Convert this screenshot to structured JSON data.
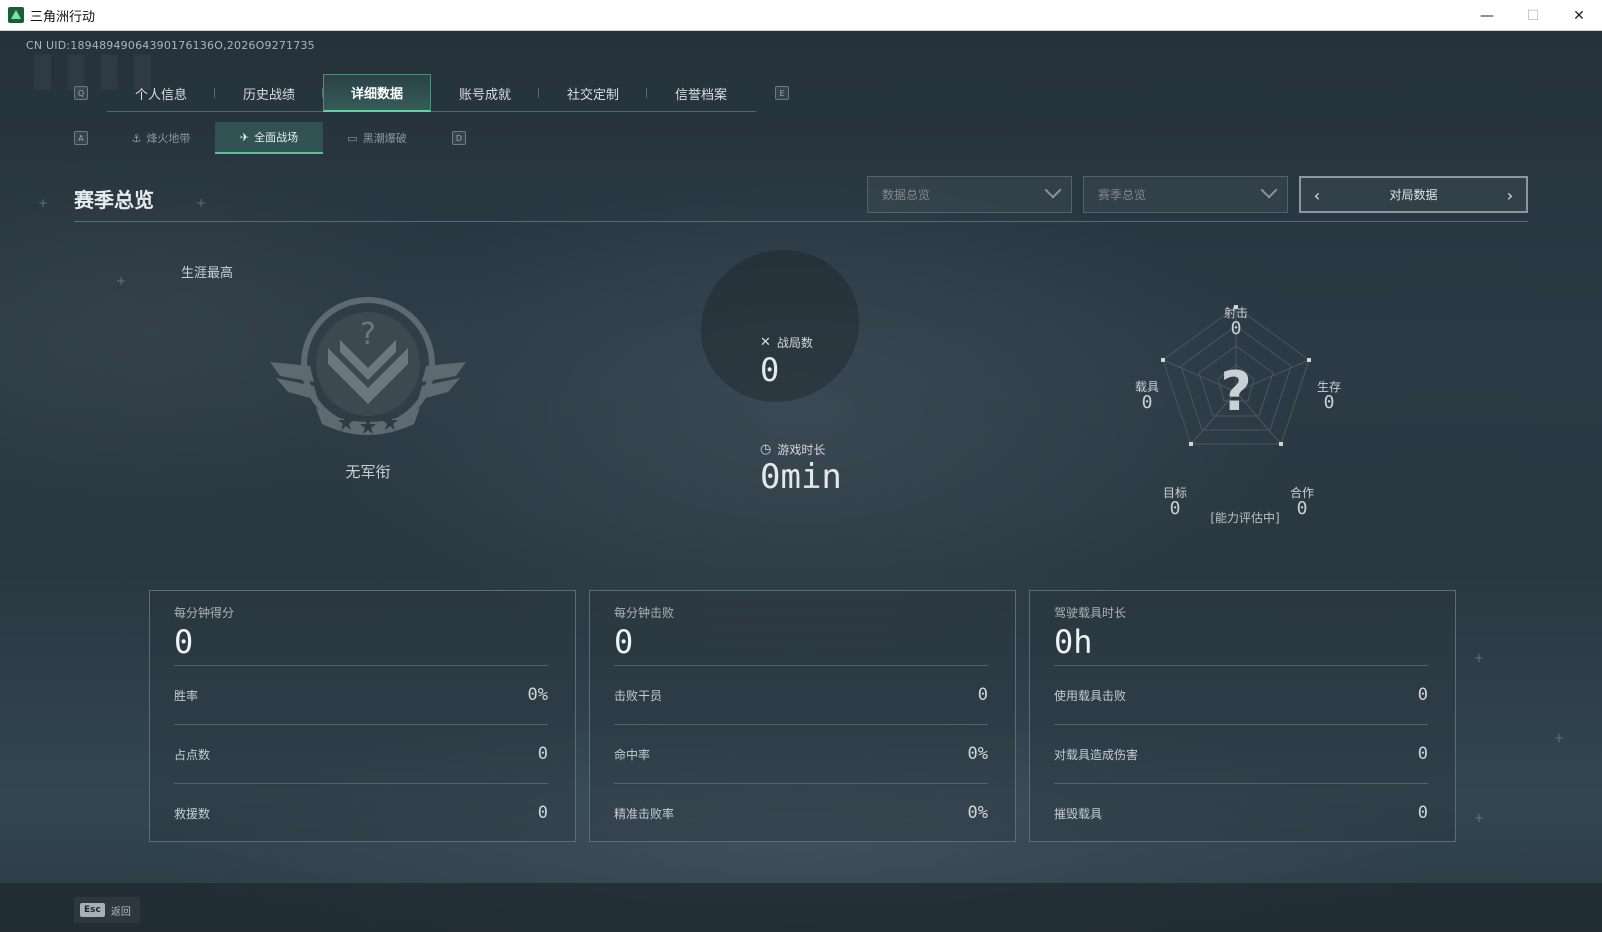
{
  "window": {
    "title": "三角洲行动",
    "minimize": "—",
    "maximize": "☐",
    "close": "✕"
  },
  "uid": "CN UID:18948949064390176136O,2026O9271735",
  "keys": {
    "q": "Q",
    "e": "E",
    "a": "A",
    "d": "D"
  },
  "main_tabs": [
    {
      "label": "个人信息"
    },
    {
      "label": "历史战绩"
    },
    {
      "label": "详细数据"
    },
    {
      "label": "账号成就"
    },
    {
      "label": "社交定制"
    },
    {
      "label": "信誉档案"
    }
  ],
  "sub_tabs": [
    {
      "label": "烽火地带",
      "icon": "⚓"
    },
    {
      "label": "全面战场",
      "icon": "✈"
    },
    {
      "label": "黑潮爆破",
      "icon": "▭"
    }
  ],
  "section_title": "赛季总览",
  "dropdowns": {
    "data_overview": "数据总览",
    "season_overview": "赛季总览"
  },
  "match_select": {
    "label": "对局数据",
    "prev": "‹",
    "next": "›"
  },
  "career": {
    "label": "生涯最高",
    "rank_name": "无军衔"
  },
  "middle": {
    "matches_label": "战局数",
    "matches_value": "0",
    "playtime_label": "游戏时长",
    "playtime_value": "0min"
  },
  "radar": {
    "shooting": {
      "label": "射击",
      "value": "0"
    },
    "survival": {
      "label": "生存",
      "value": "0"
    },
    "teamwork": {
      "label": "合作",
      "value": "0"
    },
    "objective": {
      "label": "目标",
      "value": "0"
    },
    "vehicle": {
      "label": "载具",
      "value": "0"
    },
    "center": "?",
    "status": "[能力评估中]"
  },
  "cards": [
    {
      "head_label": "每分钟得分",
      "head_value": "0",
      "rows": [
        {
          "label": "胜率",
          "value": "0%"
        },
        {
          "label": "占点数",
          "value": "0"
        },
        {
          "label": "救援数",
          "value": "0"
        }
      ]
    },
    {
      "head_label": "每分钟击败",
      "head_value": "0",
      "rows": [
        {
          "label": "击败干员",
          "value": "0"
        },
        {
          "label": "命中率",
          "value": "0%"
        },
        {
          "label": "精准击败率",
          "value": "0%"
        }
      ]
    },
    {
      "head_label": "驾驶载具时长",
      "head_value": "0h",
      "rows": [
        {
          "label": "使用载具击败",
          "value": "0"
        },
        {
          "label": "对载具造成伤害",
          "value": "0"
        },
        {
          "label": "摧毁载具",
          "value": "0"
        }
      ]
    }
  ],
  "footer": {
    "esc_key": "Esc",
    "back_label": "返回"
  }
}
